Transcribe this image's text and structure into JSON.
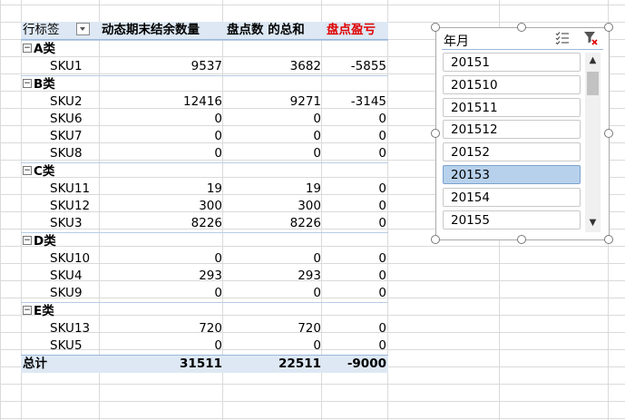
{
  "pivot": {
    "headers": {
      "row_label": "行标签",
      "col1": "动态期末结余数量",
      "col2": "盘点数 的总和",
      "col3": "盘点盈亏"
    },
    "groups": [
      {
        "name": "A类",
        "rows": [
          {
            "sku": "SKU1",
            "v1": "9537",
            "v2": "3682",
            "v3": "-5855"
          }
        ]
      },
      {
        "name": "B类",
        "rows": [
          {
            "sku": "SKU2",
            "v1": "12416",
            "v2": "9271",
            "v3": "-3145"
          },
          {
            "sku": "SKU6",
            "v1": "0",
            "v2": "0",
            "v3": "0"
          },
          {
            "sku": "SKU7",
            "v1": "0",
            "v2": "0",
            "v3": "0"
          },
          {
            "sku": "SKU8",
            "v1": "0",
            "v2": "0",
            "v3": "0"
          }
        ]
      },
      {
        "name": "C类",
        "rows": [
          {
            "sku": "SKU11",
            "v1": "19",
            "v2": "19",
            "v3": "0"
          },
          {
            "sku": "SKU12",
            "v1": "300",
            "v2": "300",
            "v3": "0"
          },
          {
            "sku": "SKU3",
            "v1": "8226",
            "v2": "8226",
            "v3": "0"
          }
        ]
      },
      {
        "name": "D类",
        "rows": [
          {
            "sku": "SKU10",
            "v1": "0",
            "v2": "0",
            "v3": "0"
          },
          {
            "sku": "SKU4",
            "v1": "293",
            "v2": "293",
            "v3": "0"
          },
          {
            "sku": "SKU9",
            "v1": "0",
            "v2": "0",
            "v3": "0"
          }
        ]
      },
      {
        "name": "E类",
        "rows": [
          {
            "sku": "SKU13",
            "v1": "720",
            "v2": "720",
            "v3": "0"
          },
          {
            "sku": "SKU5",
            "v1": "0",
            "v2": "0",
            "v3": "0"
          }
        ]
      }
    ],
    "total": {
      "label": "总计",
      "v1": "31511",
      "v2": "22511",
      "v3": "-9000"
    }
  },
  "slicer": {
    "title": "年月",
    "items": [
      "20151",
      "201510",
      "201511",
      "201512",
      "20152",
      "20153",
      "20154",
      "20155"
    ],
    "selected": "20153",
    "icons": {
      "multi_select": "multi-select-icon",
      "clear_filter": "clear-filter-icon"
    }
  },
  "colors": {
    "header_bg": "#dde8f4",
    "selected_item": "#b7d1ec",
    "red_header": "#e00000"
  }
}
